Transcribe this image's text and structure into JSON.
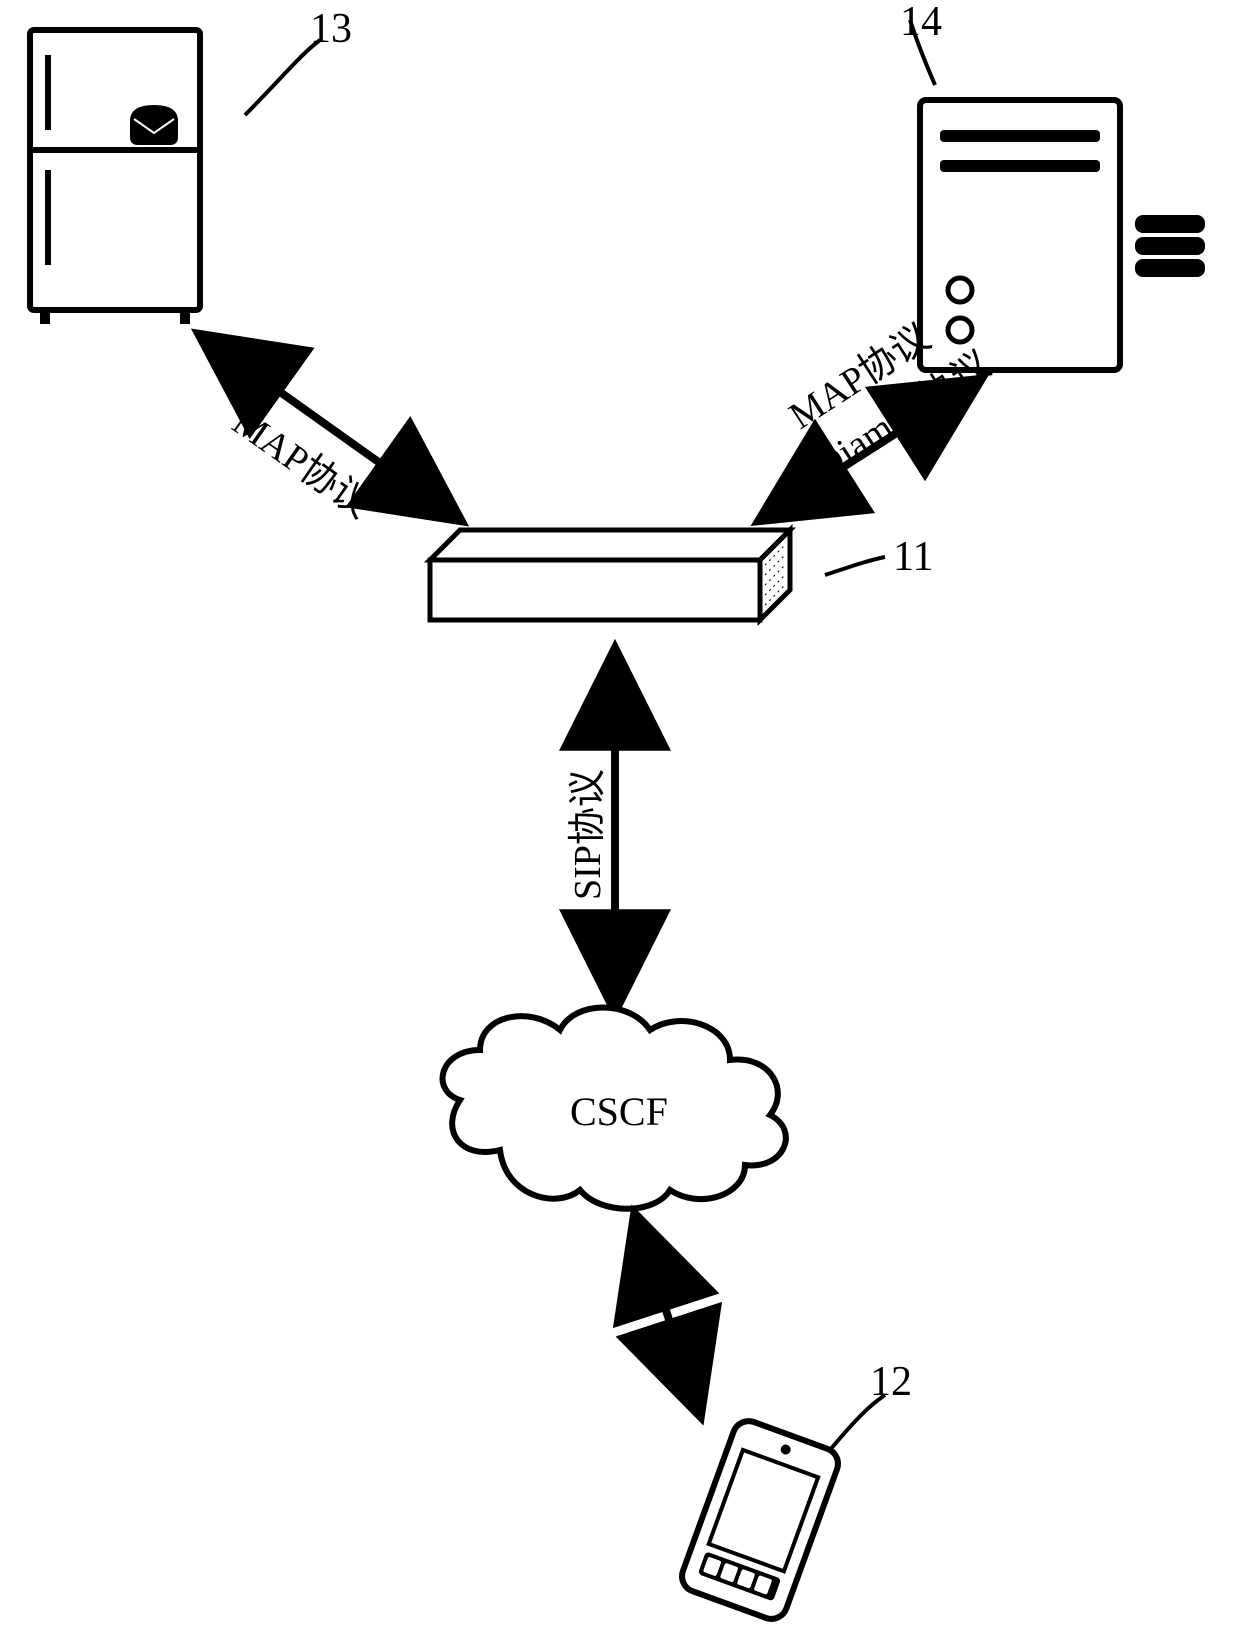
{
  "diagram": {
    "refs": {
      "fridge": "13",
      "server": "14",
      "box": "11",
      "phone": "12"
    },
    "links": {
      "fridge_box": "MAP协议",
      "server_box_top": "MAP协议",
      "server_box_bottom": "Diamter协议",
      "box_cloud": "SIP协议"
    },
    "cloud_label": "CSCF"
  }
}
